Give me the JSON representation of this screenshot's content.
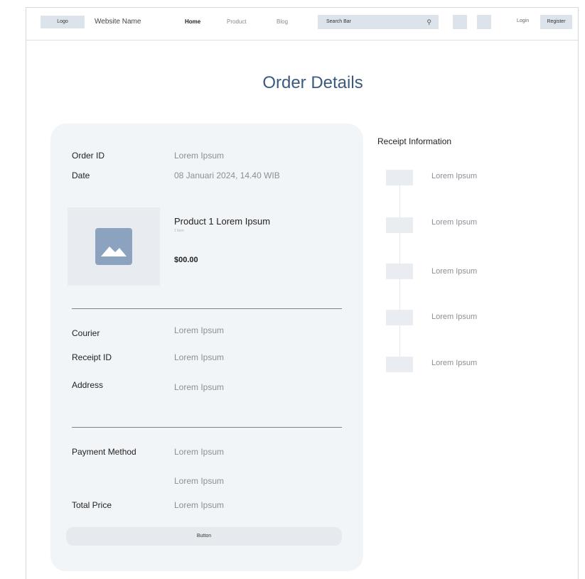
{
  "header": {
    "logo": "Logo",
    "site_name": "Website Name",
    "nav": [
      "Home",
      "Product",
      "Blog"
    ],
    "search_placeholder": "Search Bar",
    "login": "Login",
    "register": "Register"
  },
  "page": {
    "title": "Order Details"
  },
  "order": {
    "order_id_label": "Order ID",
    "order_id_value": "Lorem Ipsum",
    "date_label": "Date",
    "date_value": "08 Januari 2024, 14.40 WIB",
    "product_name": "Product 1 Lorem Ipsum",
    "product_qty": "1 item",
    "product_price": "$00.00",
    "courier_label": "Courier",
    "courier_value": "Lorem Ipsum",
    "receipt_id_label": "Receipt ID",
    "receipt_id_value": "Lorem Ipsum",
    "address_label": "Address",
    "address_value": "Lorem Ipsum",
    "payment_label": "Payment Method",
    "payment_value": "Lorem Ipsum",
    "payment_value_2": "Lorem Ipsum",
    "total_label": "Total Price",
    "total_value": "Lorem Ipsum",
    "button": "Button"
  },
  "receipt": {
    "title": "Receipt Information",
    "steps": [
      "Lorem Ipsum",
      "Lorem Ipsum",
      "Lorem Ipsum",
      "Lorem Ipsum",
      "Lorem Ipsum"
    ]
  },
  "colors": {
    "accent": "#3c5a7e",
    "card_bg": "#f2f5f8",
    "placeholder": "#dde3ea"
  }
}
